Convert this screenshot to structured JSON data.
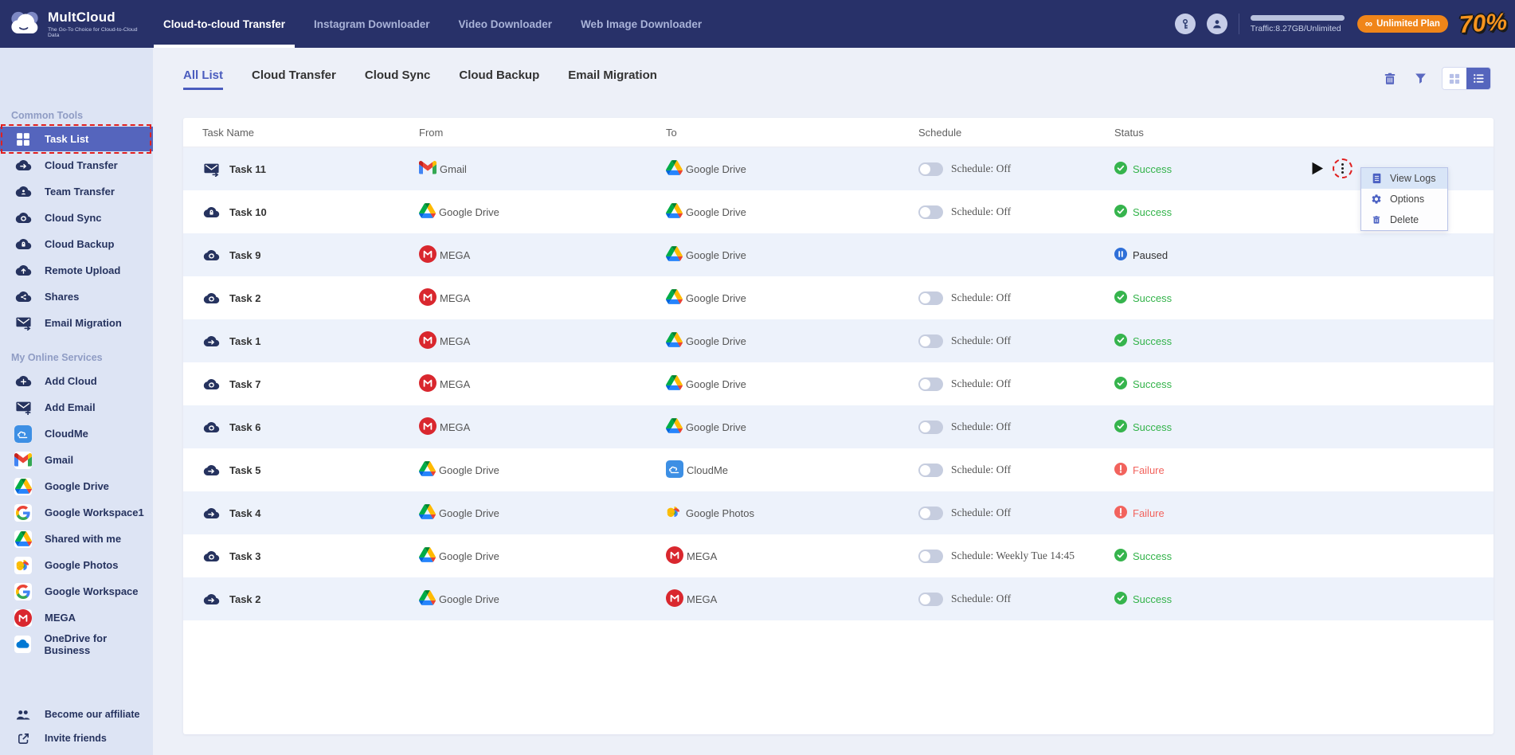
{
  "navbar": {
    "brand": {
      "name": "MultCloud",
      "tagline": "The Go-To Choice for Cloud-to-Cloud Data"
    },
    "links": [
      {
        "label": "Cloud-to-cloud Transfer",
        "active": true
      },
      {
        "label": "Instagram Downloader",
        "active": false
      },
      {
        "label": "Video Downloader",
        "active": false
      },
      {
        "label": "Web Image Downloader",
        "active": false
      }
    ],
    "icons": [
      "key-icon",
      "user-icon"
    ],
    "traffic_label": "Traffic:8.27GB/Unlimited",
    "plan_button": {
      "icon": "infinity-icon",
      "label": "Unlimited Plan"
    },
    "promo_badge": "70%"
  },
  "sidebar": {
    "sections": [
      {
        "title": "Common Tools",
        "items": [
          {
            "label": "Task List",
            "icon": "task-list-icon",
            "active": true
          },
          {
            "label": "Cloud Transfer",
            "icon": "cloud-transfer-icon",
            "active": false
          },
          {
            "label": "Team Transfer",
            "icon": "team-transfer-icon",
            "active": false
          },
          {
            "label": "Cloud Sync",
            "icon": "cloud-sync-icon",
            "active": false
          },
          {
            "label": "Cloud Backup",
            "icon": "cloud-backup-icon",
            "active": false
          },
          {
            "label": "Remote Upload",
            "icon": "remote-upload-icon",
            "active": false
          },
          {
            "label": "Shares",
            "icon": "shares-icon",
            "active": false
          },
          {
            "label": "Email Migration",
            "icon": "email-migration-icon",
            "active": false
          }
        ]
      },
      {
        "title": "My Online Services",
        "items": [
          {
            "label": "Add Cloud",
            "icon": "add-cloud-icon",
            "active": false
          },
          {
            "label": "Add Email",
            "icon": "add-email-icon",
            "active": false
          },
          {
            "label": "CloudMe",
            "icon": "cloudme-icon",
            "tile": true,
            "active": false
          },
          {
            "label": "Gmail",
            "icon": "gmail-icon",
            "tile": true,
            "active": false
          },
          {
            "label": "Google Drive",
            "icon": "google-drive-icon",
            "tile": true,
            "active": false
          },
          {
            "label": "Google Workspace1",
            "icon": "google-g-icon",
            "tile": true,
            "active": false
          },
          {
            "label": "Shared with me",
            "icon": "google-drive-icon",
            "tile": true,
            "active": false
          },
          {
            "label": "Google Photos",
            "icon": "google-photos-icon",
            "tile": true,
            "active": false
          },
          {
            "label": "Google Workspace",
            "icon": "google-g-icon",
            "tile": true,
            "active": false
          },
          {
            "label": "MEGA",
            "icon": "mega-icon",
            "tile": true,
            "active": false
          },
          {
            "label": "OneDrive for Business",
            "icon": "onedrive-icon",
            "tile": true,
            "active": false
          }
        ]
      }
    ],
    "footer_links": [
      {
        "label": "Become our affiliate",
        "icon": "affiliate-icon"
      },
      {
        "label": "Invite friends",
        "icon": "invite-icon"
      }
    ]
  },
  "main": {
    "tabs": [
      {
        "label": "All List",
        "active": true
      },
      {
        "label": "Cloud Transfer",
        "active": false
      },
      {
        "label": "Cloud Sync",
        "active": false
      },
      {
        "label": "Cloud Backup",
        "active": false
      },
      {
        "label": "Email Migration",
        "active": false
      }
    ],
    "toolbar_icons": [
      "delete-icon",
      "filter-icon",
      "grid-view-icon",
      "list-view-icon"
    ],
    "table": {
      "columns": [
        "Task Name",
        "From",
        "To",
        "Schedule",
        "Status"
      ],
      "rows": [
        {
          "name": "Task 11",
          "type_icon": "email-migration-icon",
          "from": "Gmail",
          "from_icon": "gmail-icon",
          "to": "Google Drive",
          "to_icon": "google-drive-icon",
          "schedule": "Schedule: Off",
          "toggle": true,
          "status": "Success",
          "status_kind": "success",
          "actions": true
        },
        {
          "name": "Task 10",
          "type_icon": "cloud-backup-icon",
          "from": "Google Drive",
          "from_icon": "google-drive-icon",
          "to": "Google Drive",
          "to_icon": "google-drive-icon",
          "schedule": "Schedule: Off",
          "toggle": true,
          "status": "Success",
          "status_kind": "success",
          "actions": false
        },
        {
          "name": "Task 9",
          "type_icon": "cloud-sync-icon",
          "from": "MEGA",
          "from_icon": "mega-icon",
          "to": "Google Drive",
          "to_icon": "google-drive-icon",
          "schedule": "",
          "toggle": false,
          "status": "Paused",
          "status_kind": "paused",
          "actions": false
        },
        {
          "name": "Task 2",
          "type_icon": "cloud-sync-icon",
          "from": "MEGA",
          "from_icon": "mega-icon",
          "to": "Google Drive",
          "to_icon": "google-drive-icon",
          "schedule": "Schedule: Off",
          "toggle": true,
          "status": "Success",
          "status_kind": "success",
          "actions": false
        },
        {
          "name": "Task 1",
          "type_icon": "cloud-transfer-icon",
          "from": "MEGA",
          "from_icon": "mega-icon",
          "to": "Google Drive",
          "to_icon": "google-drive-icon",
          "schedule": "Schedule: Off",
          "toggle": true,
          "status": "Success",
          "status_kind": "success",
          "actions": false
        },
        {
          "name": "Task 7",
          "type_icon": "cloud-sync-icon",
          "from": "MEGA",
          "from_icon": "mega-icon",
          "to": "Google Drive",
          "to_icon": "google-drive-icon",
          "schedule": "Schedule: Off",
          "toggle": true,
          "status": "Success",
          "status_kind": "success",
          "actions": false
        },
        {
          "name": "Task 6",
          "type_icon": "cloud-sync-icon",
          "from": "MEGA",
          "from_icon": "mega-icon",
          "to": "Google Drive",
          "to_icon": "google-drive-icon",
          "schedule": "Schedule: Off",
          "toggle": true,
          "status": "Success",
          "status_kind": "success",
          "actions": false
        },
        {
          "name": "Task 5",
          "type_icon": "cloud-transfer-icon",
          "from": "Google Drive",
          "from_icon": "google-drive-icon",
          "to": "CloudMe",
          "to_icon": "cloudme-icon",
          "schedule": "Schedule: Off",
          "toggle": true,
          "status": "Failure",
          "status_kind": "failure",
          "actions": false
        },
        {
          "name": "Task 4",
          "type_icon": "cloud-transfer-icon",
          "from": "Google Drive",
          "from_icon": "google-drive-icon",
          "to": "Google Photos",
          "to_icon": "google-photos-icon",
          "schedule": "Schedule: Off",
          "toggle": true,
          "status": "Failure",
          "status_kind": "failure",
          "actions": false
        },
        {
          "name": "Task 3",
          "type_icon": "cloud-sync-icon",
          "from": "Google Drive",
          "from_icon": "google-drive-icon",
          "to": "MEGA",
          "to_icon": "mega-icon",
          "schedule": "Schedule: Weekly Tue 14:45",
          "toggle": true,
          "status": "Success",
          "status_kind": "success",
          "actions": false
        },
        {
          "name": "Task 2",
          "type_icon": "cloud-transfer-icon",
          "from": "Google Drive",
          "from_icon": "google-drive-icon",
          "to": "MEGA",
          "to_icon": "mega-icon",
          "schedule": "Schedule: Off",
          "toggle": true,
          "status": "Success",
          "status_kind": "success",
          "actions": false
        }
      ]
    },
    "context_menu": {
      "items": [
        {
          "label": "View Logs",
          "icon": "logs-icon",
          "highlighted": true
        },
        {
          "label": "Options",
          "icon": "gear-icon",
          "highlighted": false
        },
        {
          "label": "Delete",
          "icon": "trash-small-icon",
          "highlighted": false
        }
      ]
    }
  },
  "colors": {
    "navbar_bg": "#283169",
    "sidebar_bg": "#dde4f4",
    "accent": "#4a5cbe",
    "active_item": "#5565bd",
    "success": "#33b34a",
    "failure": "#f2635d",
    "paused": "#2e6fd8",
    "plan_orange": "#f08519",
    "annotation_red": "#e01f1f",
    "alt_row": "#edf2fb"
  }
}
